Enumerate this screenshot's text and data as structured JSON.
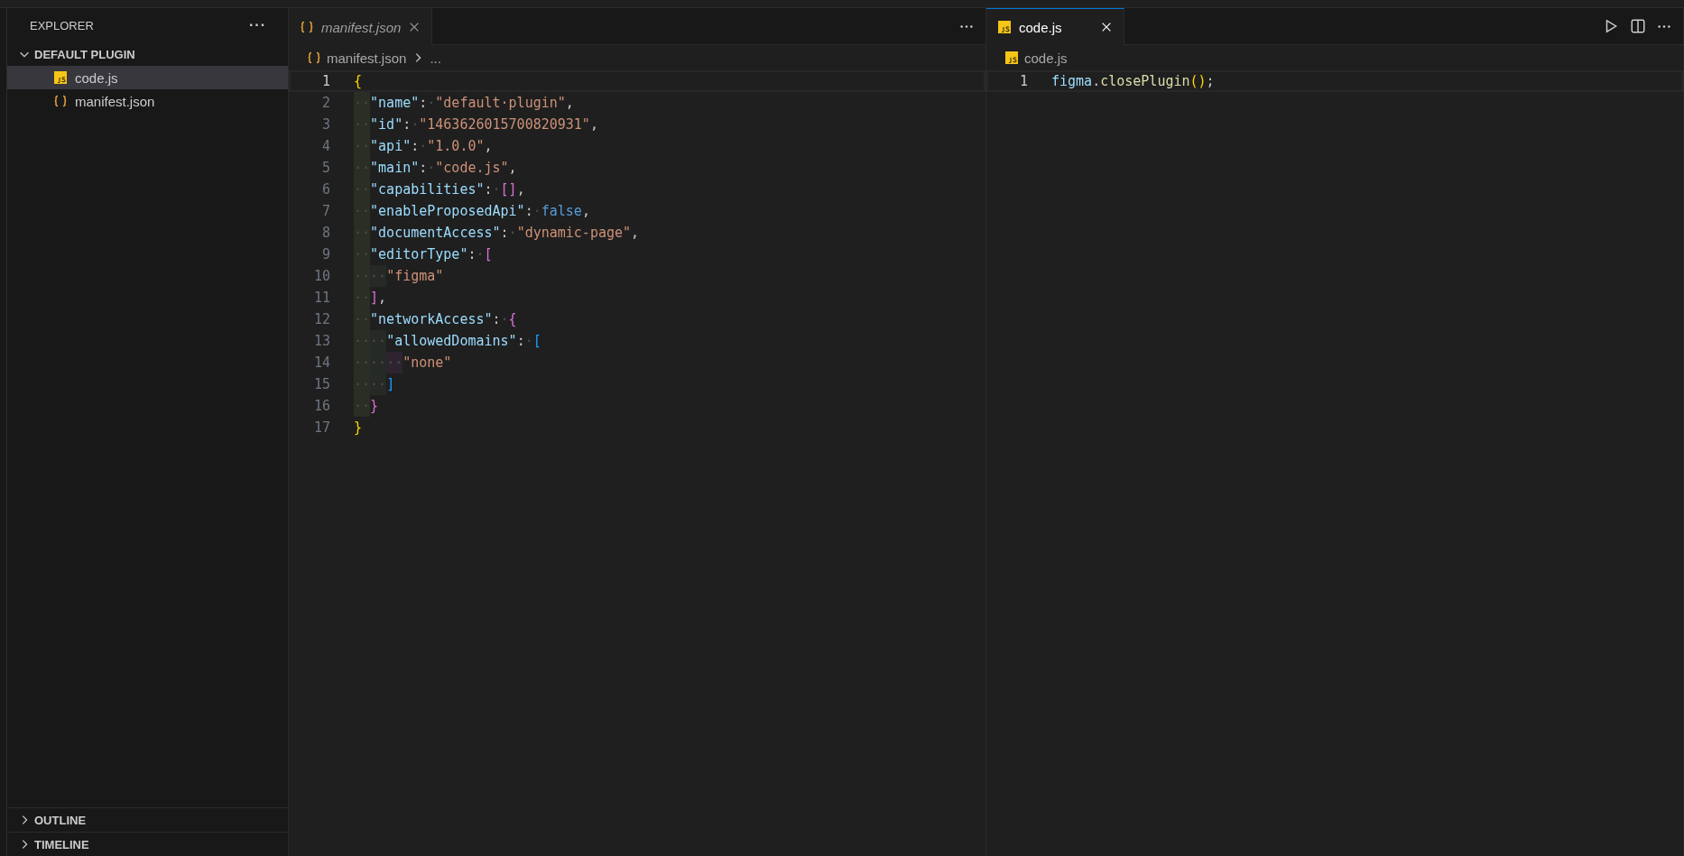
{
  "sidebar": {
    "title": "EXPLORER",
    "more": "···",
    "folder": {
      "label": "DEFAULT PLUGIN",
      "expanded": true,
      "files": [
        {
          "name": "code.js",
          "kind": "js",
          "selected": true
        },
        {
          "name": "manifest.json",
          "kind": "json",
          "selected": false
        }
      ]
    },
    "sections": [
      {
        "label": "OUTLINE",
        "expanded": false
      },
      {
        "label": "TIMELINE",
        "expanded": false
      }
    ]
  },
  "editors": [
    {
      "tabs": [
        {
          "label": "manifest.json",
          "kind": "json",
          "preview": true,
          "selected": true
        }
      ],
      "focused": false,
      "breadcrumb": {
        "file": "manifest.json",
        "kind": "json",
        "rest": "..."
      },
      "lines": [
        {
          "number": "1",
          "current": true,
          "tokens": [
            {
              "kind": "bracket1",
              "text": "{"
            }
          ]
        },
        {
          "number": "2",
          "current": false,
          "tokens": [
            {
              "kind": "indent",
              "text": "··"
            },
            {
              "kind": "key",
              "text": "\"name\""
            },
            {
              "kind": "punct",
              "text": ":"
            },
            {
              "kind": "ws",
              "text": "·"
            },
            {
              "kind": "string",
              "text": "\"default·plugin\""
            },
            {
              "kind": "punct",
              "text": ","
            }
          ]
        },
        {
          "number": "3",
          "current": false,
          "tokens": [
            {
              "kind": "indent",
              "text": "··"
            },
            {
              "kind": "key",
              "text": "\"id\""
            },
            {
              "kind": "punct",
              "text": ":"
            },
            {
              "kind": "ws",
              "text": "·"
            },
            {
              "kind": "string",
              "text": "\"1463626015700820931\""
            },
            {
              "kind": "punct",
              "text": ","
            }
          ]
        },
        {
          "number": "4",
          "current": false,
          "tokens": [
            {
              "kind": "indent",
              "text": "··"
            },
            {
              "kind": "key",
              "text": "\"api\""
            },
            {
              "kind": "punct",
              "text": ":"
            },
            {
              "kind": "ws",
              "text": "·"
            },
            {
              "kind": "string",
              "text": "\"1.0.0\""
            },
            {
              "kind": "punct",
              "text": ","
            }
          ]
        },
        {
          "number": "5",
          "current": false,
          "tokens": [
            {
              "kind": "indent",
              "text": "··"
            },
            {
              "kind": "key",
              "text": "\"main\""
            },
            {
              "kind": "punct",
              "text": ":"
            },
            {
              "kind": "ws",
              "text": "·"
            },
            {
              "kind": "string",
              "text": "\"code.js\""
            },
            {
              "kind": "punct",
              "text": ","
            }
          ]
        },
        {
          "number": "6",
          "current": false,
          "tokens": [
            {
              "kind": "indent",
              "text": "··"
            },
            {
              "kind": "key",
              "text": "\"capabilities\""
            },
            {
              "kind": "punct",
              "text": ":"
            },
            {
              "kind": "ws",
              "text": "·"
            },
            {
              "kind": "bracket2",
              "text": "[]"
            },
            {
              "kind": "punct",
              "text": ","
            }
          ]
        },
        {
          "number": "7",
          "current": false,
          "tokens": [
            {
              "kind": "indent",
              "text": "··"
            },
            {
              "kind": "key",
              "text": "\"enableProposedApi\""
            },
            {
              "kind": "punct",
              "text": ":"
            },
            {
              "kind": "ws",
              "text": "·"
            },
            {
              "kind": "keyword",
              "text": "false"
            },
            {
              "kind": "punct",
              "text": ","
            }
          ]
        },
        {
          "number": "8",
          "current": false,
          "tokens": [
            {
              "kind": "indent",
              "text": "··"
            },
            {
              "kind": "key",
              "text": "\"documentAccess\""
            },
            {
              "kind": "punct",
              "text": ":"
            },
            {
              "kind": "ws",
              "text": "·"
            },
            {
              "kind": "string",
              "text": "\"dynamic-page\""
            },
            {
              "kind": "punct",
              "text": ","
            }
          ]
        },
        {
          "number": "9",
          "current": false,
          "tokens": [
            {
              "kind": "indent",
              "text": "··"
            },
            {
              "kind": "key",
              "text": "\"editorType\""
            },
            {
              "kind": "punct",
              "text": ":"
            },
            {
              "kind": "ws",
              "text": "·"
            },
            {
              "kind": "bracket2",
              "text": "["
            }
          ]
        },
        {
          "number": "10",
          "current": false,
          "tokens": [
            {
              "kind": "indent",
              "text": "··"
            },
            {
              "kind": "indent",
              "text": "··"
            },
            {
              "kind": "string",
              "text": "\"figma\""
            }
          ]
        },
        {
          "number": "11",
          "current": false,
          "tokens": [
            {
              "kind": "indent",
              "text": "··"
            },
            {
              "kind": "bracket2",
              "text": "]"
            },
            {
              "kind": "punct",
              "text": ","
            }
          ]
        },
        {
          "number": "12",
          "current": false,
          "tokens": [
            {
              "kind": "indent",
              "text": "··"
            },
            {
              "kind": "key",
              "text": "\"networkAccess\""
            },
            {
              "kind": "punct",
              "text": ":"
            },
            {
              "kind": "ws",
              "text": "·"
            },
            {
              "kind": "bracket2",
              "text": "{"
            }
          ]
        },
        {
          "number": "13",
          "current": false,
          "tokens": [
            {
              "kind": "indent",
              "text": "··"
            },
            {
              "kind": "indent",
              "text": "··"
            },
            {
              "kind": "key",
              "text": "\"allowedDomains\""
            },
            {
              "kind": "punct",
              "text": ":"
            },
            {
              "kind": "ws",
              "text": "·"
            },
            {
              "kind": "bracket3",
              "text": "["
            }
          ]
        },
        {
          "number": "14",
          "current": false,
          "tokens": [
            {
              "kind": "indent",
              "text": "··"
            },
            {
              "kind": "indent",
              "text": "··"
            },
            {
              "kind": "indent",
              "text": "··"
            },
            {
              "kind": "string",
              "text": "\"none\""
            }
          ]
        },
        {
          "number": "15",
          "current": false,
          "tokens": [
            {
              "kind": "indent",
              "text": "··"
            },
            {
              "kind": "indent",
              "text": "··"
            },
            {
              "kind": "bracket3",
              "text": "]"
            }
          ]
        },
        {
          "number": "16",
          "current": false,
          "tokens": [
            {
              "kind": "indent",
              "text": "··"
            },
            {
              "kind": "bracket2",
              "text": "}"
            }
          ]
        },
        {
          "number": "17",
          "current": false,
          "tokens": [
            {
              "kind": "bracket1",
              "text": "}"
            }
          ]
        }
      ]
    },
    {
      "tabs": [
        {
          "label": "code.js",
          "kind": "js",
          "preview": false,
          "selected": true
        }
      ],
      "focused": true,
      "breadcrumb": {
        "file": "code.js",
        "kind": "js"
      },
      "lines": [
        {
          "number": "1",
          "current": true,
          "tokens": [
            {
              "kind": "key",
              "text": "figma"
            },
            {
              "kind": "punct",
              "text": "."
            },
            {
              "kind": "func",
              "text": "closePlugin"
            },
            {
              "kind": "bracket1",
              "text": "()"
            },
            {
              "kind": "punct",
              "text": ";"
            }
          ]
        }
      ]
    }
  ]
}
